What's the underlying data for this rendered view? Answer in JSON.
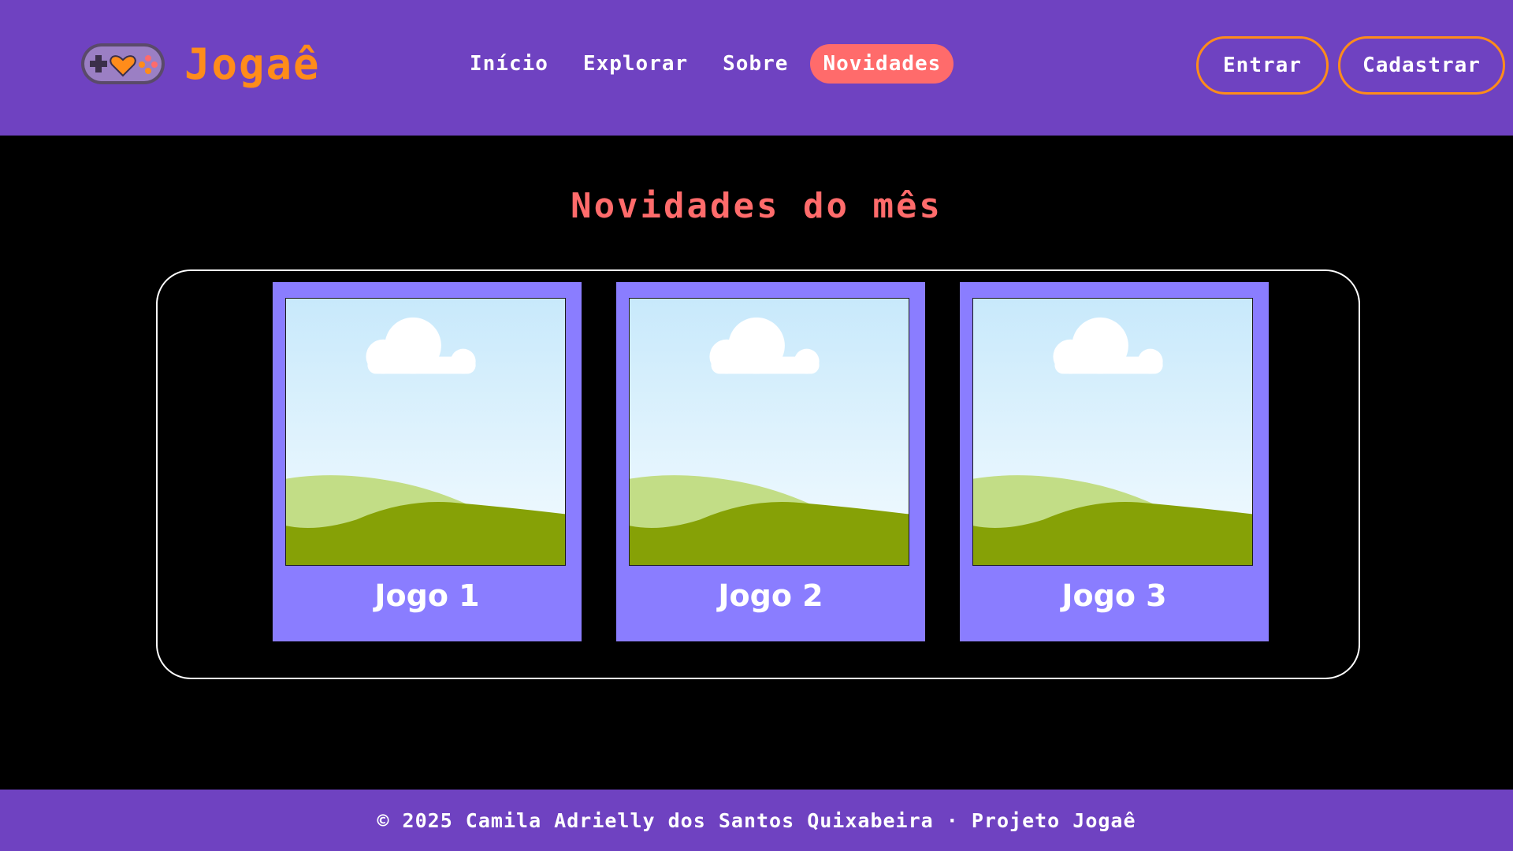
{
  "header": {
    "brand": "Jogaê",
    "nav": [
      {
        "label": "Início",
        "active": false
      },
      {
        "label": "Explorar",
        "active": false
      },
      {
        "label": "Sobre",
        "active": false
      },
      {
        "label": "Novidades",
        "active": true
      }
    ],
    "login_label": "Entrar",
    "signup_label": "Cadastrar",
    "logo_icon": "gamepad-heart-icon"
  },
  "main": {
    "title": "Novidades do mês",
    "cards": [
      {
        "title": "Jogo 1",
        "image_icon": "landscape-placeholder-icon"
      },
      {
        "title": "Jogo 2",
        "image_icon": "landscape-placeholder-icon"
      },
      {
        "title": "Jogo 3",
        "image_icon": "landscape-placeholder-icon"
      }
    ]
  },
  "footer": {
    "text": "© 2025 Camila Adrielly dos Santos Quixabeira · Projeto Jogaê"
  },
  "colors": {
    "header_bg": "#6f42c1",
    "brand": "#ff8c1a",
    "accent": "#ff6b6b",
    "card_bg": "#8a7dff",
    "page_bg": "#000000"
  }
}
